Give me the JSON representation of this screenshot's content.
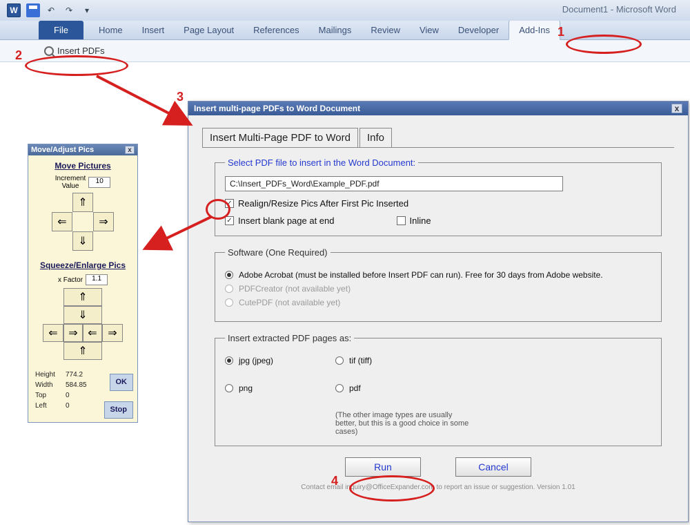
{
  "window": {
    "doc_title": "Document1  -  Microsoft Word"
  },
  "qat": {
    "undo": "↶",
    "redo": "↷",
    "dd": "▾"
  },
  "ribbon": {
    "file": "File",
    "tabs": [
      "Home",
      "Insert",
      "Page Layout",
      "References",
      "Mailings",
      "Review",
      "View",
      "Developer",
      "Add-Ins"
    ]
  },
  "addins": {
    "insert_pdfs": "Insert PDFs"
  },
  "movepanel": {
    "title": "Move/Adjust Pics",
    "close": "x",
    "move_head": "Move Pictures",
    "incr_label": "Increment\nValue",
    "incr_value": "10",
    "up": "⇑",
    "down": "⇓",
    "left": "⇐",
    "right": "⇒",
    "sq_head": "Squeeze/Enlarge Pics",
    "xfactor_label": "x Factor",
    "xfactor_value": "1.1",
    "sq_up": "⇑",
    "sq_down": "⇓",
    "sq_inL": "⇒",
    "sq_inR": "⇐",
    "sq_outL": "⇐",
    "sq_outR": "⇒",
    "stats": {
      "height_l": "Height",
      "height_v": "774.2",
      "width_l": "Width",
      "width_v": "584.85",
      "top_l": "Top",
      "top_v": "0",
      "left_l": "Left",
      "left_v": "0"
    },
    "ok": "OK",
    "stop": "Stop"
  },
  "dialog": {
    "title": "Insert multi-page PDFs to Word Document",
    "close": "x",
    "tab_main": "Insert Multi-Page PDF to Word",
    "tab_info": "Info",
    "group_select": "Select PDF file to insert in the Word Document:",
    "pdf_path": "C:\\Insert_PDFs_Word\\Example_PDF.pdf",
    "chk_realign": "Realign/Resize Pics After First Pic Inserted",
    "chk_blank": "Insert blank page at end",
    "chk_inline": "Inline",
    "group_software": "Software (One Required)",
    "radio_acrobat": "Adobe Acrobat (must be installed before Insert PDF can run).  Free for 30 days from Adobe website.",
    "radio_pdfcreator": "PDFCreator (not available yet)",
    "radio_cutepdf": "CutePDF (not available yet)",
    "group_format": "Insert extracted PDF pages as:",
    "fmt_jpg": "jpg (jpeg)",
    "fmt_tif": "tif (tiff)",
    "fmt_png": "png",
    "fmt_pdf": "pdf",
    "fmt_note": "(The other image types are usually better, but this is a good choice in some cases)",
    "btn_run": "Run",
    "btn_cancel": "Cancel",
    "footer": "Contact email inquiry@OfficeExpander.com to report an issue or suggestion.   Version 1.01"
  },
  "anno": {
    "n1": "1",
    "n2": "2",
    "n3": "3",
    "n4": "4"
  }
}
